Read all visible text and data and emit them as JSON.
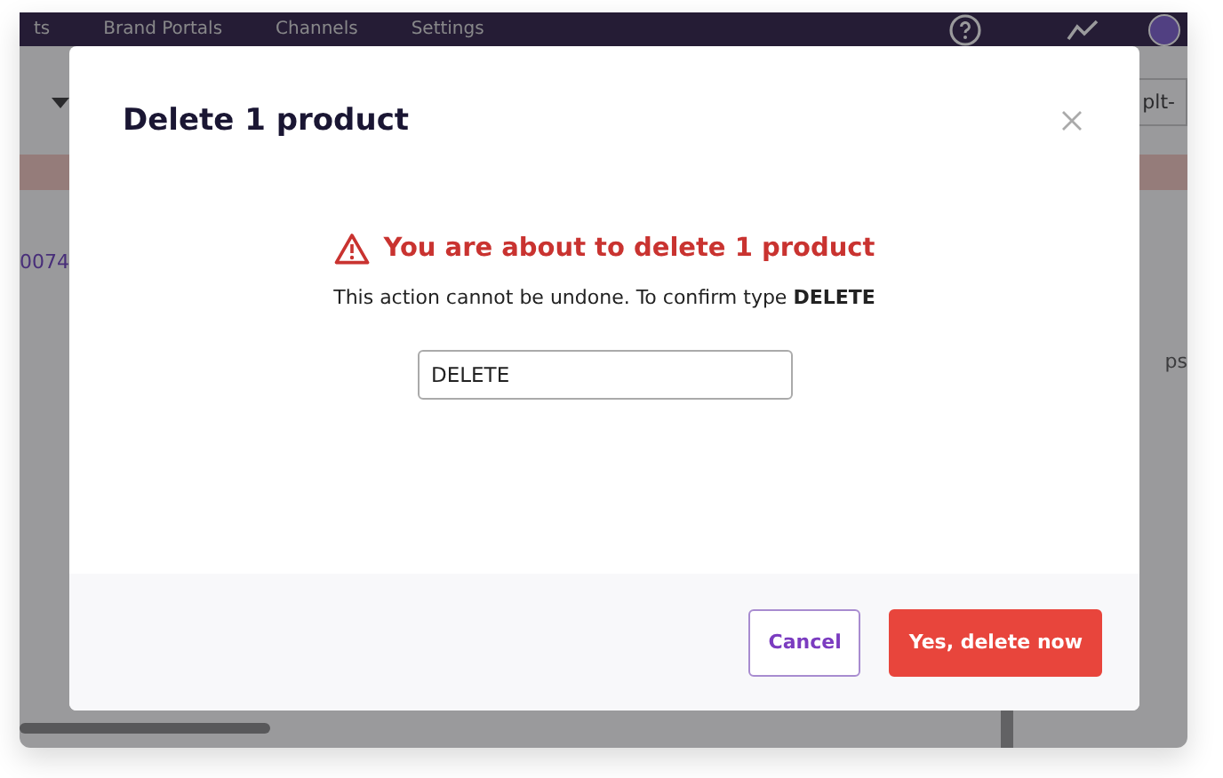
{
  "nav": {
    "items": [
      {
        "label": "ts"
      },
      {
        "label": "Brand Portals"
      },
      {
        "label": "Channels"
      },
      {
        "label": "Settings"
      }
    ]
  },
  "background": {
    "row_id": "0074",
    "filter_chip": "plt-",
    "column_text": "ps"
  },
  "dialog": {
    "title": "Delete 1 product",
    "warning": "You are about to delete 1 product",
    "message": "This action cannot be undone. To confirm type **DELETE**",
    "input": {
      "value": "DELETE"
    },
    "buttons": [
      {
        "label": "Cancel",
        "kind": "secondary"
      },
      {
        "label": "Yes, delete now",
        "kind": "danger"
      }
    ]
  }
}
